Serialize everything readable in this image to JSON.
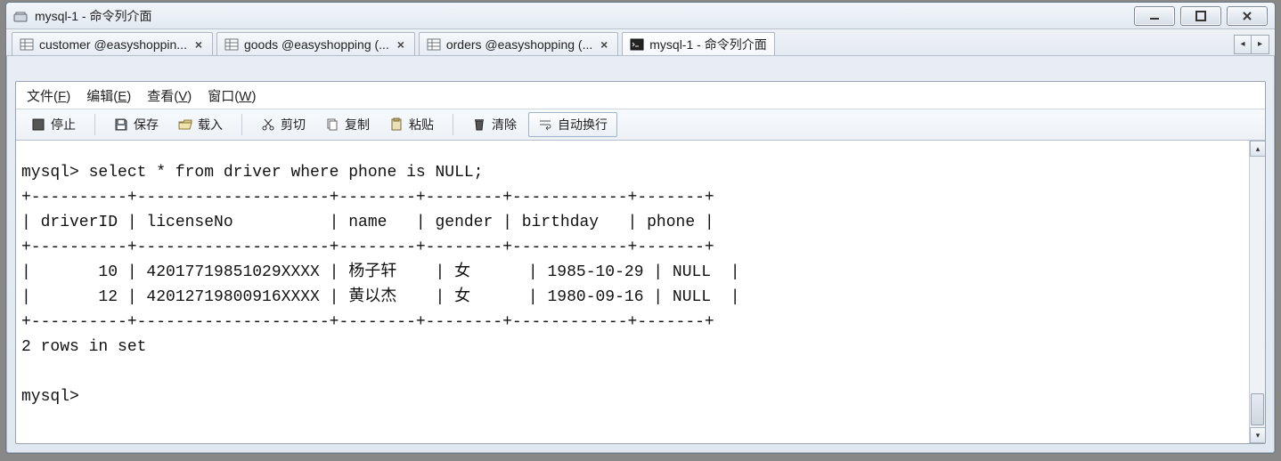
{
  "window": {
    "title": "mysql-1 - 命令列介面"
  },
  "tabs": [
    {
      "label": "customer @easyshoppin...",
      "kind": "table",
      "closable": true
    },
    {
      "label": "goods @easyshopping (...",
      "kind": "table",
      "closable": true
    },
    {
      "label": "orders @easyshopping (...",
      "kind": "table",
      "closable": true
    },
    {
      "label": "mysql-1 - 命令列介面",
      "kind": "console",
      "closable": false,
      "active": true
    }
  ],
  "menubar": [
    {
      "label": "文件",
      "mnemonic": "F"
    },
    {
      "label": "编辑",
      "mnemonic": "E"
    },
    {
      "label": "查看",
      "mnemonic": "V"
    },
    {
      "label": "窗口",
      "mnemonic": "W"
    }
  ],
  "toolbar": {
    "stop": "停止",
    "save": "保存",
    "load": "载入",
    "cut": "剪切",
    "copy": "复制",
    "paste": "粘贴",
    "clear": "清除",
    "wrap": "自动换行"
  },
  "console": {
    "prompt": "mysql>",
    "query": "select * from driver where phone is NULL;",
    "columns": [
      "driverID",
      "licenseNo",
      "name",
      "gender",
      "birthday",
      "phone"
    ],
    "rows": [
      {
        "driverID": "10",
        "licenseNo": "42017719851029XXXX",
        "name": "杨子轩",
        "gender": "女",
        "birthday": "1985-10-29",
        "phone": "NULL"
      },
      {
        "driverID": "12",
        "licenseNo": "42012719800916XXXX",
        "name": "黄以杰",
        "gender": "女",
        "birthday": "1980-09-16",
        "phone": "NULL"
      }
    ],
    "footer": "2 rows in set",
    "border": "+----------+--------------------+--------+--------+------------+-------+",
    "header_row": "| driverID | licenseNo          | name   | gender | birthday   | phone |"
  },
  "chart_data": {
    "type": "table",
    "title": "select * from driver where phone is NULL;",
    "columns": [
      "driverID",
      "licenseNo",
      "name",
      "gender",
      "birthday",
      "phone"
    ],
    "rows": [
      [
        "10",
        "42017719851029XXXX",
        "杨子轩",
        "女",
        "1985-10-29",
        "NULL"
      ],
      [
        "12",
        "42012719800916XXXX",
        "黄以杰",
        "女",
        "1980-09-16",
        "NULL"
      ]
    ],
    "footer": "2 rows in set"
  }
}
